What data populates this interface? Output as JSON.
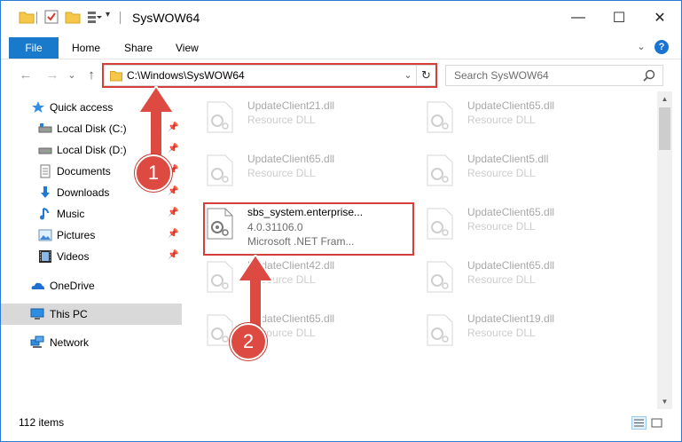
{
  "window": {
    "title": "SysWOW64",
    "minimize_glyph": "—",
    "maximize_glyph": "☐",
    "close_glyph": "✕"
  },
  "ribbon": {
    "file": "File",
    "home": "Home",
    "share": "Share",
    "view": "View",
    "chevron": "⌄",
    "help": "?"
  },
  "nav": {
    "back": "←",
    "forward": "→",
    "recent": "⌄",
    "up": "↑",
    "address": "C:\\Windows\\SysWOW64",
    "address_dropdown": "⌄",
    "refresh": "↻",
    "search_placeholder": "Search SysWOW64"
  },
  "sidebar": {
    "items": [
      {
        "label": "Quick access",
        "icon": "star-icon",
        "pinned": false
      },
      {
        "label": "Local Disk (C:)",
        "icon": "drive-icon",
        "pinned": true
      },
      {
        "label": "Local Disk (D:)",
        "icon": "drive-icon",
        "pinned": true
      },
      {
        "label": "Documents",
        "icon": "documents-icon",
        "pinned": true
      },
      {
        "label": "Downloads",
        "icon": "downloads-icon",
        "pinned": true
      },
      {
        "label": "Music",
        "icon": "music-icon",
        "pinned": true
      },
      {
        "label": "Pictures",
        "icon": "pictures-icon",
        "pinned": true
      },
      {
        "label": "Videos",
        "icon": "videos-icon",
        "pinned": true
      },
      {
        "label": "OneDrive",
        "icon": "onedrive-icon",
        "pinned": false
      },
      {
        "label": "This PC",
        "icon": "computer-icon",
        "pinned": false,
        "selected": true
      },
      {
        "label": "Network",
        "icon": "network-icon",
        "pinned": false
      }
    ]
  },
  "files": [
    {
      "name": "UpdateClient21.dll",
      "type": "Resource DLL",
      "faded": true
    },
    {
      "name": "UpdateClient65.dll",
      "type": "Resource DLL",
      "faded": true
    },
    {
      "name": "UpdateClient65.dll",
      "type": "Resource DLL",
      "faded": true
    },
    {
      "name": "UpdateClient5.dll",
      "type": "Resource DLL",
      "faded": true
    },
    {
      "name": "sbs_system.enterprise...",
      "version": "4.0.31106.0",
      "type": "Microsoft .NET Fram...",
      "faded": false,
      "highlighted": true
    },
    {
      "name": "UpdateClient65.dll",
      "type": "Resource DLL",
      "faded": true
    },
    {
      "name": "UpdateClient42.dll",
      "type": "Resource DLL",
      "faded": true
    },
    {
      "name": "UpdateClient65.dll",
      "type": "Resource DLL",
      "faded": true
    },
    {
      "name": "UpdateClient65.dll",
      "type": "Resource DLL",
      "faded": true
    },
    {
      "name": "UpdateClient19.dll",
      "type": "Resource DLL",
      "faded": true
    }
  ],
  "status": {
    "count": "112 items"
  },
  "annotations": {
    "marker_1": "1",
    "marker_2": "2",
    "color": "#dc4a41"
  },
  "colors": {
    "accent": "#1979ca",
    "selection": "#d9d9d9",
    "annotation_red": "#d43f3a"
  }
}
